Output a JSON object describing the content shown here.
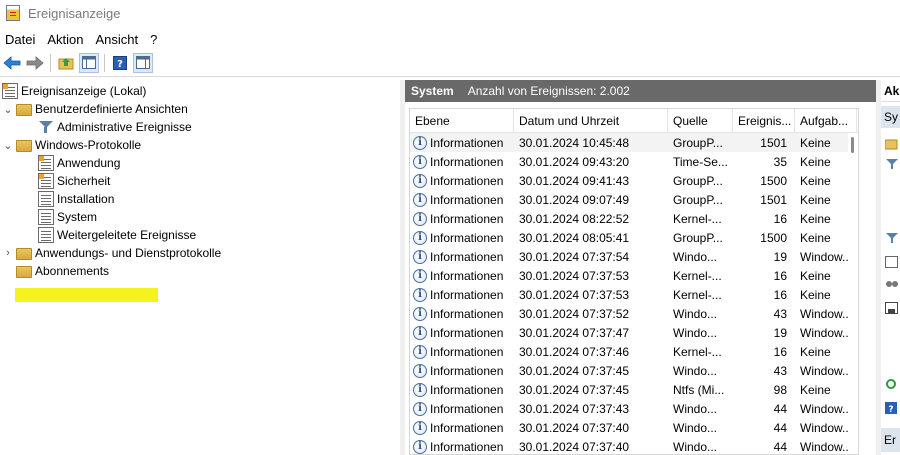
{
  "window": {
    "title": "Ereignisanzeige"
  },
  "menu": [
    "Datei",
    "Aktion",
    "Ansicht",
    "?"
  ],
  "toolbar": [
    "back-icon",
    "forward-icon",
    "folder-up-icon",
    "console-tree-icon",
    "help-icon",
    "action-pane-icon"
  ],
  "tree": {
    "root": "Ereignisanzeige (Lokal)",
    "custom_views": "Benutzerdefinierte Ansichten",
    "admin_events": "Administrative Ereignisse",
    "windows_logs": "Windows-Protokolle",
    "application": "Anwendung",
    "security": "Sicherheit",
    "installation": "Installation",
    "system": "System",
    "forwarded": "Weitergeleitete Ereignisse",
    "app_service_logs": "Anwendungs- und Dienstprotokolle",
    "subscriptions": "Abonnements"
  },
  "center": {
    "name": "System",
    "count": "Anzahl von Ereignissen: 2.002",
    "columns": [
      "Ebene",
      "Datum und Uhrzeit",
      "Quelle",
      "Ereignis...",
      "Aufgab..."
    ],
    "rows": [
      {
        "level": "Informationen",
        "date": "30.01.2024 10:45:48",
        "source": "GroupP...",
        "id": "1501",
        "task": "Keine"
      },
      {
        "level": "Informationen",
        "date": "30.01.2024 09:43:20",
        "source": "Time-Se...",
        "id": "35",
        "task": "Keine"
      },
      {
        "level": "Informationen",
        "date": "30.01.2024 09:41:43",
        "source": "GroupP...",
        "id": "1500",
        "task": "Keine"
      },
      {
        "level": "Informationen",
        "date": "30.01.2024 09:07:49",
        "source": "GroupP...",
        "id": "1501",
        "task": "Keine"
      },
      {
        "level": "Informationen",
        "date": "30.01.2024 08:22:52",
        "source": "Kernel-...",
        "id": "16",
        "task": "Keine"
      },
      {
        "level": "Informationen",
        "date": "30.01.2024 08:05:41",
        "source": "GroupP...",
        "id": "1500",
        "task": "Keine"
      },
      {
        "level": "Informationen",
        "date": "30.01.2024 07:37:54",
        "source": "Windo...",
        "id": "19",
        "task": "Window..."
      },
      {
        "level": "Informationen",
        "date": "30.01.2024 07:37:53",
        "source": "Kernel-...",
        "id": "16",
        "task": "Keine"
      },
      {
        "level": "Informationen",
        "date": "30.01.2024 07:37:53",
        "source": "Kernel-...",
        "id": "16",
        "task": "Keine"
      },
      {
        "level": "Informationen",
        "date": "30.01.2024 07:37:52",
        "source": "Windo...",
        "id": "43",
        "task": "Window..."
      },
      {
        "level": "Informationen",
        "date": "30.01.2024 07:37:47",
        "source": "Windo...",
        "id": "19",
        "task": "Window..."
      },
      {
        "level": "Informationen",
        "date": "30.01.2024 07:37:46",
        "source": "Kernel-...",
        "id": "16",
        "task": "Keine"
      },
      {
        "level": "Informationen",
        "date": "30.01.2024 07:37:45",
        "source": "Windo...",
        "id": "43",
        "task": "Window..."
      },
      {
        "level": "Informationen",
        "date": "30.01.2024 07:37:45",
        "source": "Ntfs (Mi...",
        "id": "98",
        "task": "Keine"
      },
      {
        "level": "Informationen",
        "date": "30.01.2024 07:37:43",
        "source": "Windo...",
        "id": "44",
        "task": "Window..."
      },
      {
        "level": "Informationen",
        "date": "30.01.2024 07:37:40",
        "source": "Windo...",
        "id": "44",
        "task": "Window..."
      },
      {
        "level": "Informationen",
        "date": "30.01.2024 07:37:40",
        "source": "Windo...",
        "id": "44",
        "task": "Window..."
      }
    ]
  },
  "actions": {
    "header": "Ak",
    "sub1": "Sy",
    "sub2": "Er"
  },
  "colors": {
    "header_bg": "#696969",
    "highlight": "#f5f21c",
    "actions_sub_bg": "#dce4ee"
  }
}
